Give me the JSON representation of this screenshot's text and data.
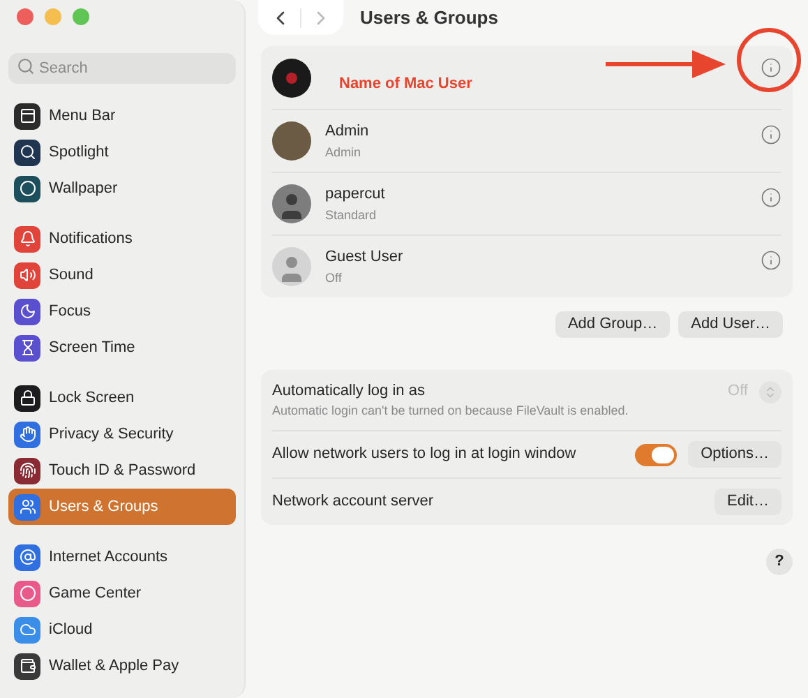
{
  "sidebar": {
    "search": {
      "placeholder": "Search"
    },
    "groups": [
      {
        "items": [
          {
            "label": "Menu Bar",
            "selected": false,
            "color": "#2b2b2b"
          },
          {
            "label": "Spotlight",
            "selected": false,
            "color": "#1f3550"
          },
          {
            "label": "Wallpaper",
            "selected": false,
            "color": "#1d4e5c"
          }
        ]
      },
      {
        "items": [
          {
            "label": "Notifications",
            "selected": false,
            "color": "#e0443a"
          },
          {
            "label": "Sound",
            "selected": false,
            "color": "#e0443a"
          },
          {
            "label": "Focus",
            "selected": false,
            "color": "#5a4fcf"
          },
          {
            "label": "Screen Time",
            "selected": false,
            "color": "#5a4fcf"
          }
        ]
      },
      {
        "items": [
          {
            "label": "Lock Screen",
            "selected": false,
            "color": "#1c1c1e"
          },
          {
            "label": "Privacy & Security",
            "selected": false,
            "color": "#2f6fe0"
          },
          {
            "label": "Touch ID & Password",
            "selected": false,
            "color": "#8a2a32"
          },
          {
            "label": "Users & Groups",
            "selected": true,
            "color": "#2f6fe0"
          }
        ]
      },
      {
        "items": [
          {
            "label": "Internet Accounts",
            "selected": false,
            "color": "#2f6fe0"
          },
          {
            "label": "Game Center",
            "selected": false,
            "color": "#e85a8a"
          },
          {
            "label": "iCloud",
            "selected": false,
            "color": "#3b8ee8"
          },
          {
            "label": "Wallet & Apple Pay",
            "selected": false,
            "color": "#3a3a3a"
          }
        ]
      }
    ]
  },
  "header": {
    "title": "Users & Groups"
  },
  "users": [
    {
      "kind": "record",
      "name": "Name of Mac User",
      "annotated": true
    },
    {
      "kind": "bird",
      "name": "Admin",
      "role": "Admin",
      "annotated": false
    },
    {
      "kind": "silhouette-dark",
      "name": "papercut",
      "role": "Standard",
      "annotated": false
    },
    {
      "kind": "silhouette-light",
      "name": "Guest User",
      "role": "Off",
      "annotated": false
    }
  ],
  "user_buttons": [
    "Add Group…",
    "Add User…"
  ],
  "login_settings": [
    {
      "kind": "popup",
      "label": "Automatically log in as",
      "note": "Automatic login can't be turned on because FileVault is enabled.",
      "value": "Off",
      "disabled": true
    },
    {
      "kind": "toggle",
      "label": "Allow network users to log in at login window",
      "on": true,
      "button": "Options…"
    },
    {
      "kind": "button",
      "label": "Network account server",
      "button": "Edit…"
    }
  ],
  "help": "?"
}
